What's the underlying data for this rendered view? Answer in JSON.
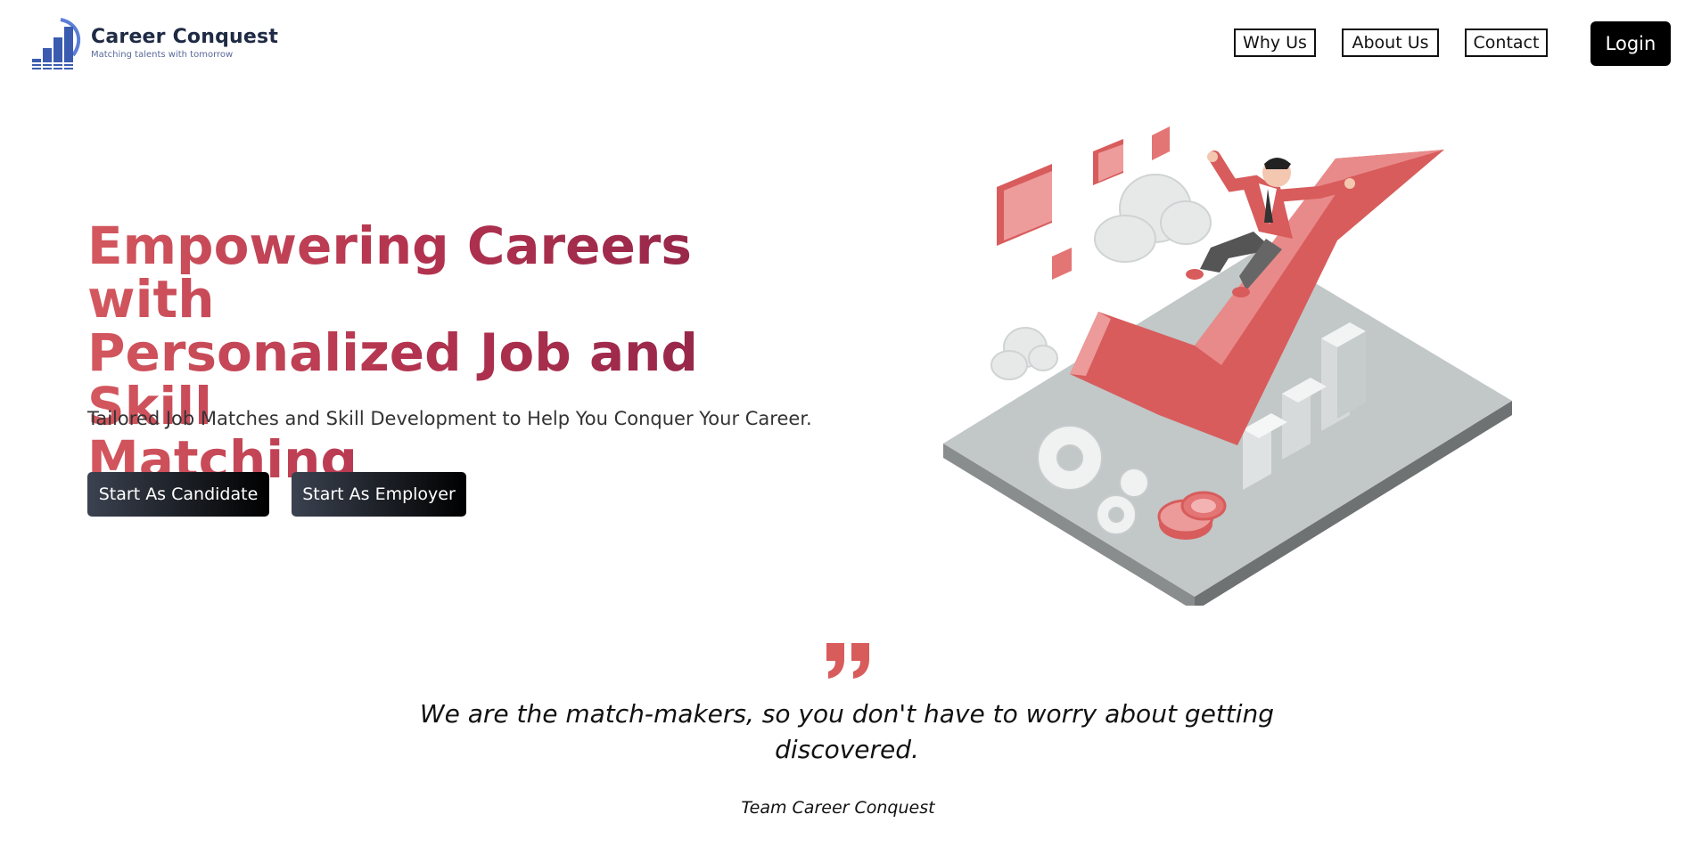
{
  "brand": {
    "name": "Career Conquest",
    "tagline": "Matching talents with tomorrow"
  },
  "nav": {
    "items": [
      {
        "label": "Why Us"
      },
      {
        "label": "About Us"
      },
      {
        "label": "Contact"
      }
    ],
    "login_label": "Login"
  },
  "hero": {
    "title_line1": "Empowering Careers with",
    "title_line2": "Personalized Job and Skill",
    "title_line3": "Matching",
    "subtitle": "Tailored Job Matches and Skill Development to Help You Conquer Your Career.",
    "cta_candidate": "Start As Candidate",
    "cta_employer": "Start As Employer"
  },
  "testimonial": {
    "quote_line1": "We are the match-makers, so you don't have to worry about getting",
    "quote_line2": "discovered.",
    "author": "Team Career Conquest"
  },
  "colors": {
    "accent_red": "#d85c5c",
    "brand_blue": "#3a5bb0",
    "dark_button": "#000000"
  },
  "icons": {
    "logo": "bar-chart-logo-icon",
    "quote": "quote-icon",
    "hero_image": "career-success-checkmark-illustration"
  }
}
